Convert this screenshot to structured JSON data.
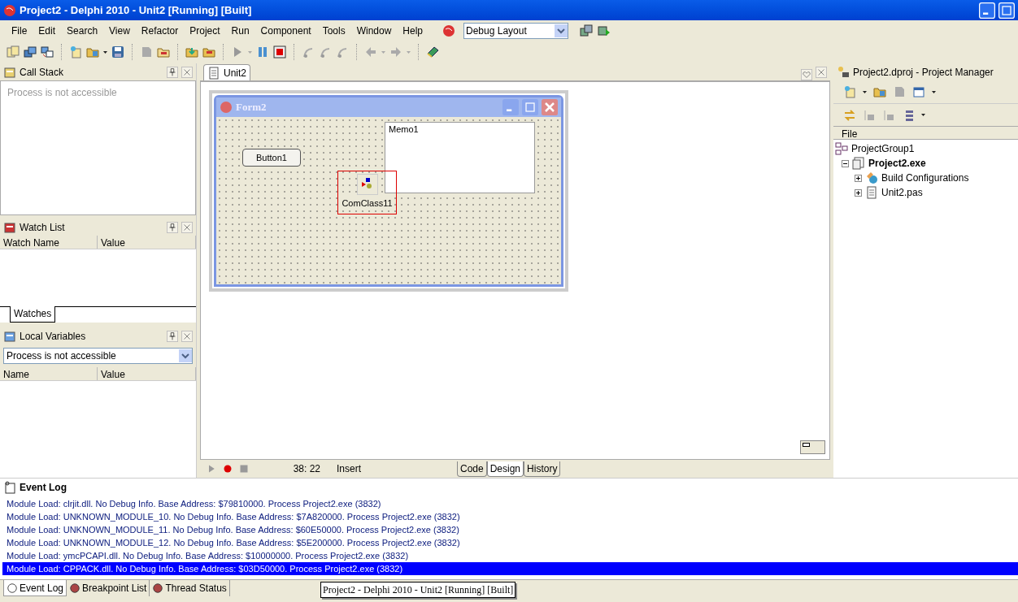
{
  "window": {
    "title": "Project2 - Delphi 2010 - Unit2 [Running] [Built]"
  },
  "menu": [
    "File",
    "Edit",
    "Search",
    "View",
    "Refactor",
    "Project",
    "Run",
    "Component",
    "Tools",
    "Window",
    "Help"
  ],
  "layout_combo": {
    "value": "Debug Layout"
  },
  "call_stack": {
    "title": "Call Stack",
    "message": "Process is not accessible"
  },
  "watch_list": {
    "title": "Watch List",
    "columns": [
      "Watch Name",
      "Value"
    ],
    "tabs": [
      {
        "label": "Watches",
        "selected": true
      }
    ]
  },
  "local_variables": {
    "title": "Local Variables",
    "combo": "Process is not accessible",
    "columns": [
      "Name",
      "Value"
    ]
  },
  "editor": {
    "tabs": [
      {
        "label": "Unit2",
        "selected": true
      }
    ],
    "form": {
      "title": "Form2",
      "button": "Button1",
      "memo": "Memo1",
      "component": "ComClass11"
    },
    "status": {
      "position": "38: 22",
      "mode": "Insert"
    },
    "view_tabs": [
      {
        "label": "Code",
        "selected": false
      },
      {
        "label": "Design",
        "selected": true
      },
      {
        "label": "History",
        "selected": false
      }
    ]
  },
  "project_manager": {
    "title": "Project2.dproj - Project Manager",
    "column": "File",
    "tree": [
      {
        "label": "ProjectGroup1",
        "kind": "group",
        "active": false,
        "children": [
          {
            "label": "Project2.exe",
            "kind": "project",
            "active": true,
            "expanded": true,
            "children": [
              {
                "label": "Build Configurations",
                "kind": "configs",
                "active": false,
                "expanded": false
              },
              {
                "label": "Unit2.pas",
                "kind": "unit",
                "active": false,
                "expanded": false
              }
            ]
          }
        ]
      }
    ]
  },
  "event_log": {
    "title": "Event Log",
    "rows": [
      {
        "text": "Module Load: clrjit.dll. No Debug Info. Base Address: $79810000. Process Project2.exe (3832)",
        "selected": false
      },
      {
        "text": "Module Load: UNKNOWN_MODULE_10. No Debug Info. Base Address: $7A820000. Process Project2.exe (3832)",
        "selected": false
      },
      {
        "text": "Module Load: UNKNOWN_MODULE_11. No Debug Info. Base Address: $60E50000. Process Project2.exe (3832)",
        "selected": false
      },
      {
        "text": "Module Load: UNKNOWN_MODULE_12. No Debug Info. Base Address: $5E200000. Process Project2.exe (3832)",
        "selected": false
      },
      {
        "text": "Module Load: ymcPCAPI.dll. No Debug Info. Base Address: $10000000. Process Project2.exe (3832)",
        "selected": false
      },
      {
        "text": "Module Load: CPPACK.dll. No Debug Info. Base Address: $03D50000. Process Project2.exe (3832)",
        "selected": true
      }
    ]
  },
  "bottom_tabs": [
    {
      "label": "Event Log",
      "selected": true
    },
    {
      "label": "Breakpoint List",
      "selected": false
    },
    {
      "label": "Thread Status",
      "selected": false
    }
  ],
  "tooltip": "Project2 - Delphi 2010 - Unit2 [Running] [Built]"
}
